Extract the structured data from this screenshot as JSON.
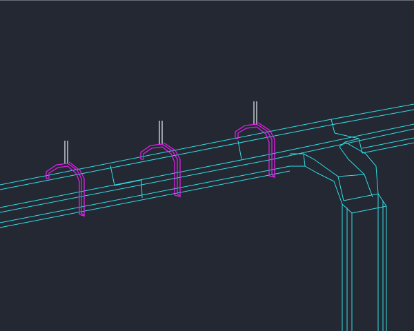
{
  "drawing": {
    "background_color": "#232833",
    "cable_tray_color": "#32e0e6",
    "hanger_color": "#e020e8",
    "rod_color": "#e8eef2",
    "hanger_count": 3
  }
}
